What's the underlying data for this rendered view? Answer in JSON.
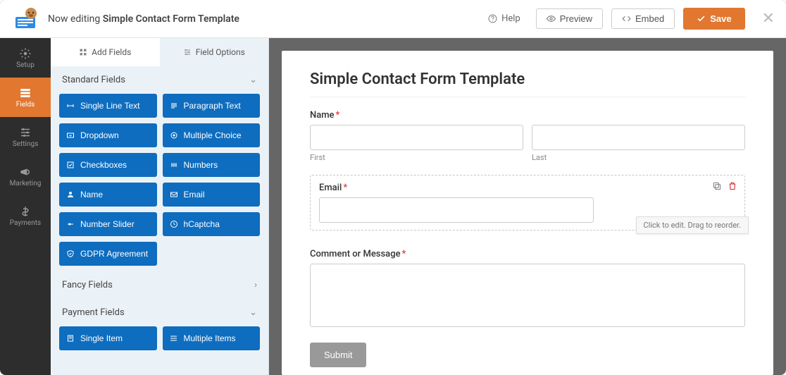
{
  "header": {
    "editing_prefix": "Now editing ",
    "editing_name": "Simple Contact Form Template",
    "help": "Help",
    "preview": "Preview",
    "embed": "Embed",
    "save": "Save"
  },
  "sidenav": {
    "setup": "Setup",
    "fields": "Fields",
    "settings": "Settings",
    "marketing": "Marketing",
    "payments": "Payments"
  },
  "panel": {
    "tabs": {
      "add": "Add Fields",
      "options": "Field Options"
    },
    "sections": {
      "standard": "Standard Fields",
      "fancy": "Fancy Fields",
      "payment": "Payment Fields"
    },
    "standard_fields": [
      "Single Line Text",
      "Paragraph Text",
      "Dropdown",
      "Multiple Choice",
      "Checkboxes",
      "Numbers",
      "Name",
      "Email",
      "Number Slider",
      "hCaptcha",
      "GDPR Agreement"
    ],
    "payment_fields": [
      "Single Item",
      "Multiple Items"
    ]
  },
  "form": {
    "title": "Simple Contact Form Template",
    "name_label": "Name",
    "first": "First",
    "last": "Last",
    "email_label": "Email",
    "comment_label": "Comment or Message",
    "submit": "Submit",
    "tooltip": "Click to edit. Drag to reorder."
  }
}
